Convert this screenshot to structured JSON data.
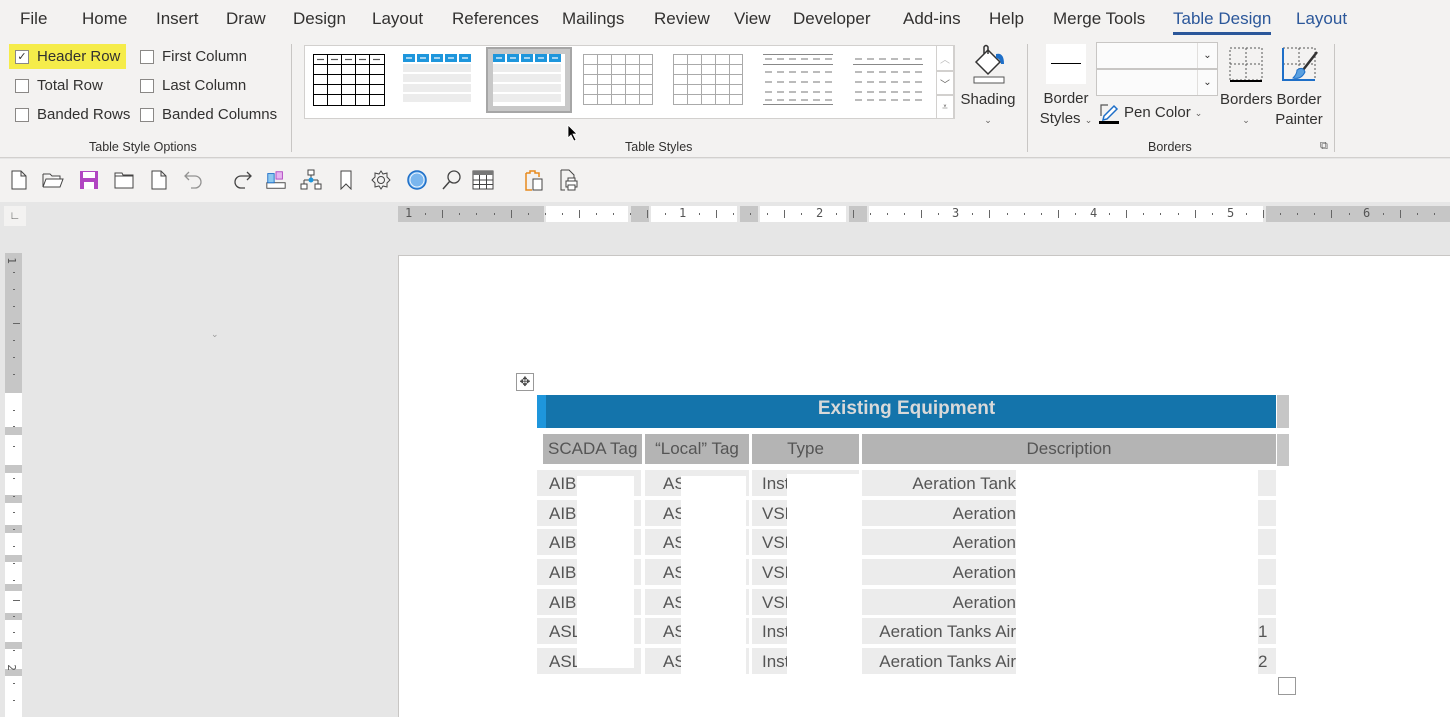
{
  "ribbon_tabs": [
    {
      "label": "File"
    },
    {
      "label": "Home"
    },
    {
      "label": "Insert"
    },
    {
      "label": "Draw"
    },
    {
      "label": "Design"
    },
    {
      "label": "Layout"
    },
    {
      "label": "References"
    },
    {
      "label": "Mailings"
    },
    {
      "label": "Review"
    },
    {
      "label": "View"
    },
    {
      "label": "Developer"
    },
    {
      "label": "Add-ins"
    },
    {
      "label": "Help"
    },
    {
      "label": "Merge Tools"
    },
    {
      "label": "Table Design",
      "active": true
    },
    {
      "label": "Layout",
      "contextual": true
    }
  ],
  "table_style_options": {
    "group_label": "Table Style Options",
    "options": [
      {
        "label": "Header Row",
        "checked": true
      },
      {
        "label": "First Column",
        "checked": false
      },
      {
        "label": "Total Row",
        "checked": false
      },
      {
        "label": "Last Column",
        "checked": false
      },
      {
        "label": "Banded Rows",
        "checked": false
      },
      {
        "label": "Banded Columns",
        "checked": false
      }
    ]
  },
  "table_styles": {
    "group_label": "Table Styles",
    "selected_index": 2,
    "count": 7
  },
  "shading": {
    "label": "Shading"
  },
  "borders": {
    "group_label": "Borders",
    "border_styles_label_1": "Border",
    "border_styles_label_2": "Styles",
    "pen_color_label": "Pen Color",
    "borders_label": "Borders",
    "border_painter_label_1": "Border",
    "border_painter_label_2": "Painter",
    "line_style_value": "",
    "line_weight_value": ""
  },
  "quick_access_icons": [
    "new-document-icon",
    "open-folder-icon",
    "save-icon",
    "folder-icon",
    "blank-page-icon",
    "undo-icon",
    "redo-icon",
    "objects-icon",
    "org-chart-icon",
    "bookmark-icon",
    "settings-icon",
    "circle-shape-icon",
    "search-icon",
    "insert-table-icon",
    "paste-icon",
    "print-preview-icon",
    "customize-qat-icon"
  ],
  "ruler": {
    "horizontal_labels": [
      "1",
      "1",
      "2",
      "3",
      "4",
      "5",
      "6"
    ],
    "vertical_labels": [
      "1",
      "2"
    ]
  },
  "colors": {
    "accent": "#2b579a",
    "table_title_bg": "#1474ab",
    "table_title_stripe": "#1e96dc",
    "header_cell_bg": "#b4b4b4",
    "body_cell_bg": "#ececec",
    "highlight": "#f5ec4a"
  },
  "document_table": {
    "title": "Existing Equipment",
    "headers": [
      "SCADA Tag",
      "“Local” Tag",
      "Type",
      "Description"
    ],
    "rows": [
      [
        "AIB",
        "AS",
        "Inst",
        "Aeration Tank",
        ""
      ],
      [
        "AIB",
        "AS",
        "VSD",
        "Aeration",
        ""
      ],
      [
        "AIB",
        "AS",
        "VSD",
        "Aeration",
        ""
      ],
      [
        "AIB",
        "AS",
        "VSD",
        "Aeration",
        ""
      ],
      [
        "AIB",
        "AS",
        "VSD",
        "Aeration",
        ""
      ],
      [
        "ASL",
        "AS",
        "Inst",
        "Aeration Tanks Air",
        "1"
      ],
      [
        "ASL",
        "AS",
        "Inst",
        "Aeration Tanks Air",
        "2"
      ]
    ]
  }
}
